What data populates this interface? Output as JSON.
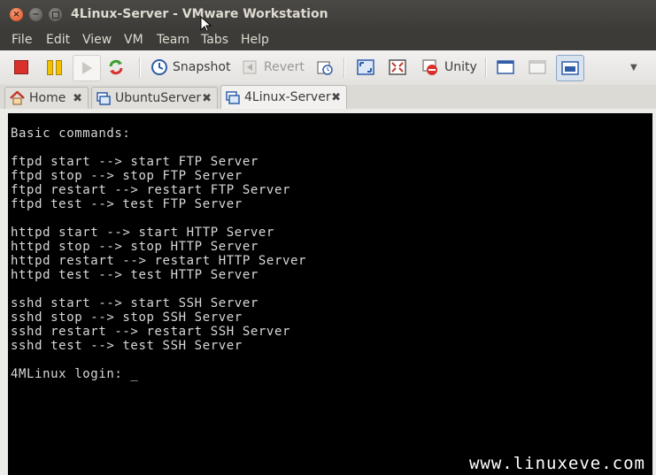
{
  "window": {
    "title": "4Linux-Server - VMware Workstation"
  },
  "menubar": {
    "items": [
      "File",
      "Edit",
      "View",
      "VM",
      "Team",
      "Tabs",
      "Help"
    ]
  },
  "toolbar": {
    "snapshot_label": "Snapshot",
    "revert_label": "Revert",
    "unity_label": "Unity"
  },
  "tabs": [
    {
      "label": "Home"
    },
    {
      "label": "UbuntuServer"
    },
    {
      "label": "4Linux-Server"
    }
  ],
  "console": {
    "lines": [
      "Basic commands:",
      "",
      "ftpd start --> start FTP Server",
      "ftpd stop --> stop FTP Server",
      "ftpd restart --> restart FTP Server",
      "ftpd test --> test FTP Server",
      "",
      "httpd start --> start HTTP Server",
      "httpd stop --> stop HTTP Server",
      "httpd restart --> restart HTTP Server",
      "httpd test --> test HTTP Server",
      "",
      "sshd start --> start SSH Server",
      "sshd stop --> stop SSH Server",
      "sshd restart --> restart SSH Server",
      "sshd test --> test SSH Server",
      "",
      "4MLinux login: _"
    ],
    "watermark": "www.linuxeve.com"
  },
  "colors": {
    "titlebar": "#3c3b37",
    "close_button": "#df4b16",
    "console_bg": "#000000",
    "console_text": "#d8d8d8"
  }
}
